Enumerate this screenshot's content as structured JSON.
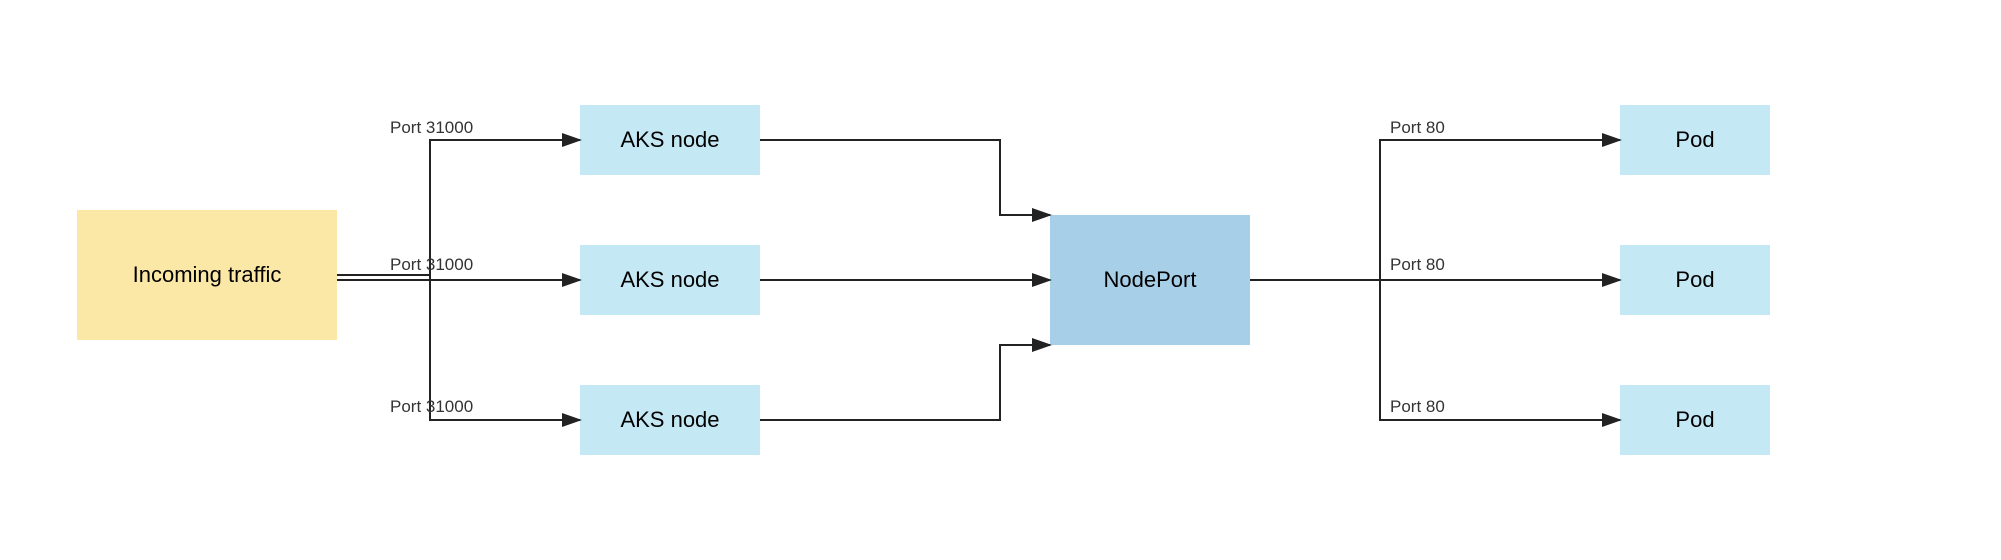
{
  "nodes": {
    "incoming": {
      "label": "Incoming traffic"
    },
    "aks1": {
      "label": "AKS node"
    },
    "aks2": {
      "label": "AKS node"
    },
    "aks3": {
      "label": "AKS node"
    },
    "nodeport": {
      "label": "NodePort"
    },
    "pod1": {
      "label": "Pod"
    },
    "pod2": {
      "label": "Pod"
    },
    "pod3": {
      "label": "Pod"
    }
  },
  "labels": {
    "port31000_top": "Port 31000",
    "port31000_mid": "Port 31000",
    "port31000_bot": "Port 31000",
    "port80_top": "Port 80",
    "port80_mid": "Port 80",
    "port80_bot": "Port 80"
  }
}
